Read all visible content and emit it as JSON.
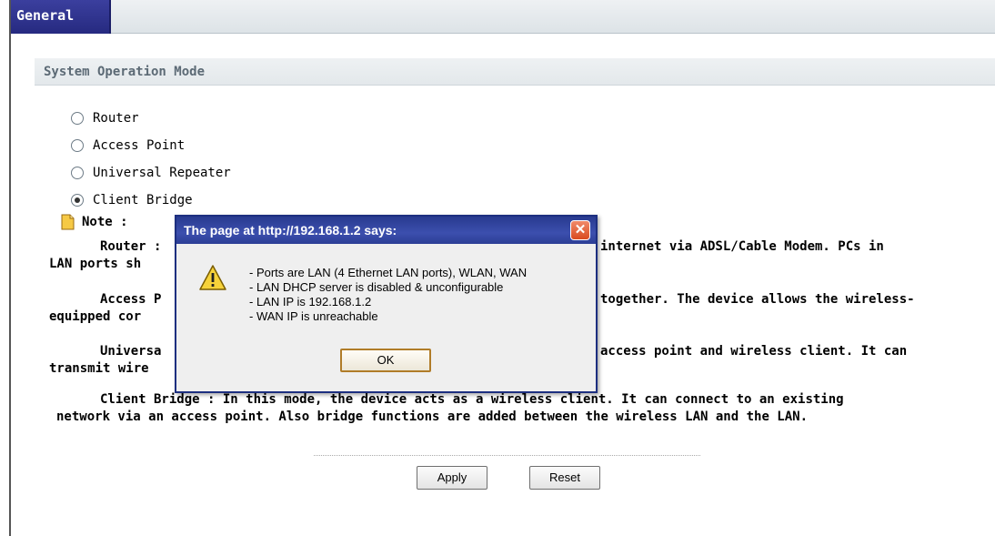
{
  "tabs": [
    {
      "label": "General"
    }
  ],
  "section": {
    "title": "System Operation Mode"
  },
  "modes": [
    {
      "label": "Router",
      "selected": false
    },
    {
      "label": "Access Point",
      "selected": false
    },
    {
      "label": "Universal Repeater",
      "selected": false
    },
    {
      "label": "Client Bridge",
      "selected": true
    }
  ],
  "note": {
    "label": "Note :",
    "lines": [
      "Router :",
      "internet via ADSL/Cable Modem. PCs in",
      "LAN ports sh",
      "Access P",
      "together. The device allows the wireless-",
      "equipped cor",
      "Universa",
      "access point and wireless client. It can",
      "transmit wire",
      "Client Bridge : In this mode, the device acts as a wireless client. It can connect to an existing",
      "network via an access point. Also bridge functions are added between the wireless LAN and the LAN."
    ]
  },
  "buttons": {
    "apply": "Apply",
    "reset": "Reset"
  },
  "dialog": {
    "title": "The page at http://192.168.1.2 says:",
    "close": "✕",
    "messages": [
      "- Ports are LAN (4 Ethernet LAN ports), WLAN, WAN",
      "- LAN DHCP server is disabled & unconfigurable",
      "- LAN IP is 192.168.1.2",
      "- WAN IP is unreachable"
    ],
    "ok": "OK"
  },
  "icons": {
    "warning": "warning-icon",
    "note": "note-icon",
    "close": "close-icon"
  }
}
